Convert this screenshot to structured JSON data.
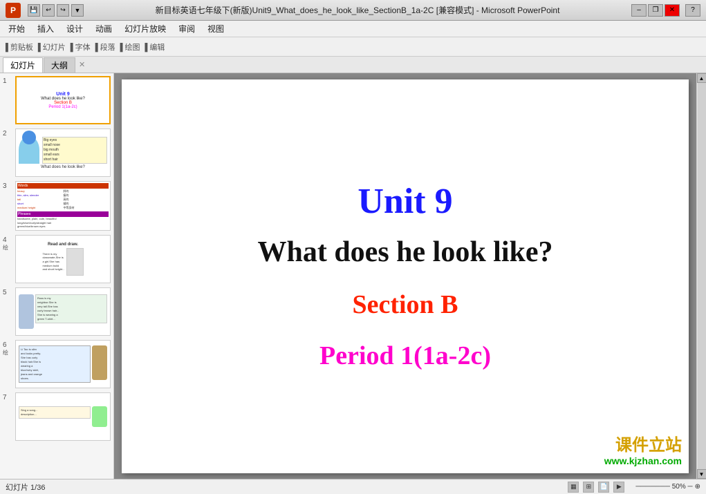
{
  "titlebar": {
    "title": "新目标英语七年级下(新版)Unit9_What_does_he_look_like_SectionB_1a-2C [兼容模式] - Microsoft PowerPoint",
    "minimize": "–",
    "restore": "❐",
    "close": "✕"
  },
  "menubar": {
    "items": [
      "开始",
      "插入",
      "设计",
      "动画",
      "幻灯片放映",
      "审阅",
      "视图"
    ]
  },
  "tabs": {
    "slide_tab": "幻灯片",
    "outline_tab": "大纲"
  },
  "slide": {
    "unit": "Unit 9",
    "subtitle": "What does he look like?",
    "section": "Section B",
    "period": "Period 1(1a-2c)"
  },
  "watermark": {
    "line1": "课件立站",
    "line2": "www.kjzhan.com"
  },
  "status": {
    "slide_info": "幻灯片 1/36"
  },
  "slides": [
    {
      "num": "1",
      "active": true
    },
    {
      "num": "2",
      "active": false
    },
    {
      "num": "3",
      "active": false
    },
    {
      "num": "4",
      "active": false
    },
    {
      "num": "5",
      "active": false
    },
    {
      "num": "6",
      "active": false
    },
    {
      "num": "7",
      "active": false
    }
  ]
}
